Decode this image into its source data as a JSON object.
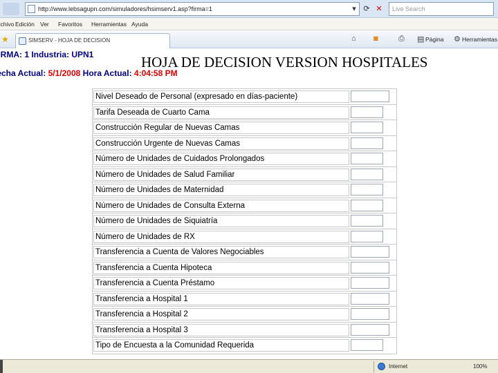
{
  "browser": {
    "address": "http://www.lebsagupn.com/simuladores/hsimserv1.asp?firma=1",
    "search_placeholder": "Live Search",
    "menu": [
      "Archivo",
      "Edición",
      "Ver",
      "Favoritos",
      "Herramientas",
      "Ayuda"
    ],
    "tab_title": "SIMSERV - HOJA DE DECISION",
    "cmd_page": "Página",
    "cmd_tools": "Herramientas"
  },
  "header": {
    "firma_label": "FIRMA",
    "firma_value": ": 1 ",
    "industria_label": "Industria",
    "industria_value": ": UPN1",
    "fecha_label": "Fecha Actual",
    "fecha_value": "5/1/2008",
    "hora_label": " Hora Actual",
    "hora_value": "4:04:58 PM",
    "title": "HOJA DE DECISION VERSION HOSPITALES"
  },
  "form": {
    "rows": [
      {
        "label": "Nivel Deseado de Personal (expresado en días-paciente)",
        "value": ""
      },
      {
        "label": "Tarifa Deseada de Cuarto Cama",
        "value": ""
      },
      {
        "label": "Construcción Regular de Nuevas Camas",
        "value": ""
      },
      {
        "label": "Construcción Urgente de Nuevas Camas",
        "value": ""
      },
      {
        "label": "Número de Unidades de Cuidados Prolongados",
        "value": ""
      },
      {
        "label": "Número de Unidades de Salud Familiar",
        "value": ""
      },
      {
        "label": "Número de Unidades de Maternidad",
        "value": ""
      },
      {
        "label": "Número de Unidades de Consulta Externa",
        "value": ""
      },
      {
        "label": "Número de Unidades de Siquiatría",
        "value": ""
      },
      {
        "label": "Número de Unidades de RX",
        "value": ""
      },
      {
        "label": "Transferencia a Cuenta de Valores Negociables",
        "value": ""
      },
      {
        "label": "Transferencia a Cuenta Hipoteca",
        "value": ""
      },
      {
        "label": "Transferencia a Cuenta Préstamo",
        "value": ""
      },
      {
        "label": "Transferencia a Hospital 1",
        "value": ""
      },
      {
        "label": "Transferencia a Hospital 2",
        "value": ""
      },
      {
        "label": "Transferencia a Hospital 3",
        "value": ""
      },
      {
        "label": "Tipo de Encuesta a la Comunidad Requerida",
        "value": ""
      }
    ]
  },
  "status": {
    "zone": "Internet",
    "zoom": "100%"
  }
}
